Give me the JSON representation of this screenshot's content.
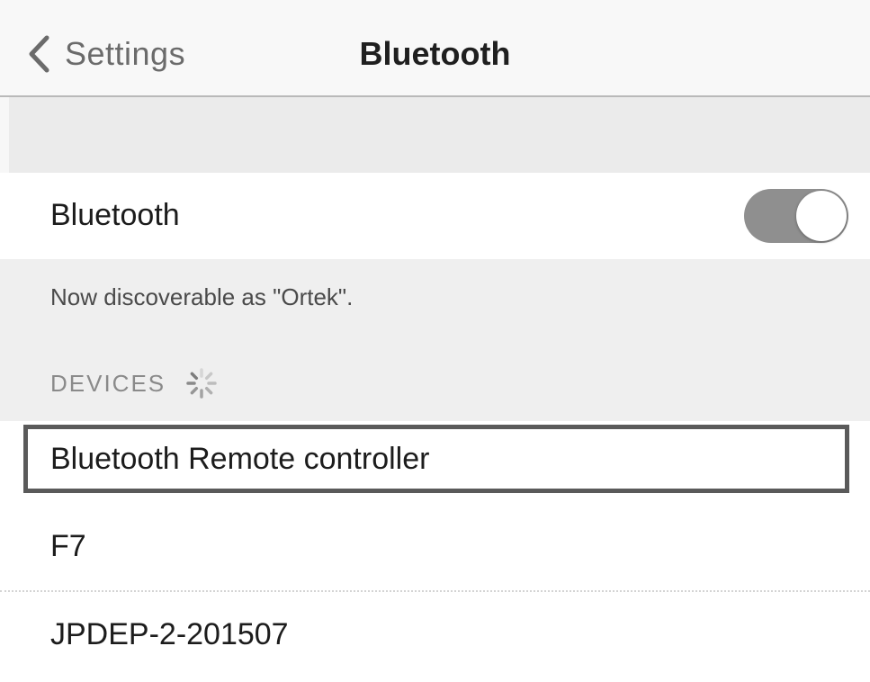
{
  "navbar": {
    "back_label": "Settings",
    "title": "Bluetooth"
  },
  "bluetooth_toggle": {
    "label": "Bluetooth",
    "enabled": true
  },
  "info": {
    "discoverable_text": "Now discoverable as \"Ortek\".",
    "devices_header": "DEVICES",
    "scanning_icon": "spinner-icon"
  },
  "devices": [
    {
      "name": "Bluetooth Remote controller",
      "selected": true
    },
    {
      "name": "F7",
      "selected": false
    },
    {
      "name": "JPDEP-2-201507",
      "selected": false
    }
  ],
  "colors": {
    "toggle_on": "#8f8f8f",
    "selection_border": "#5a5a5a",
    "background": "#f7f7f7"
  }
}
